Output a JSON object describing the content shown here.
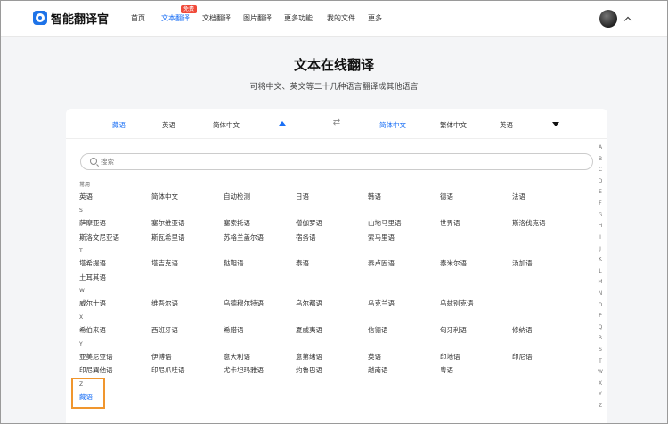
{
  "header": {
    "brand": "智能翻译官",
    "nav": [
      "首页",
      "文本翻译",
      "文档翻译",
      "图片翻译",
      "更多功能",
      "我的文件",
      "更多"
    ],
    "hot_badge": "免费"
  },
  "main": {
    "title": "文本在线翻译",
    "subtitle": "可将中文、英文等二十几种语言翻译成其他语言"
  },
  "lang_bar": {
    "source": [
      "藏语",
      "英语",
      "简体中文"
    ],
    "target": [
      "简体中文",
      "繁体中文",
      "英语"
    ]
  },
  "search": {
    "placeholder": "搜索"
  },
  "groups": {
    "common": {
      "label": "常用",
      "langs": [
        "英语",
        "简体中文",
        "自动检测",
        "日语",
        "韩语",
        "德语",
        "法语"
      ]
    },
    "s": {
      "label": "S",
      "row1": [
        "萨摩亚语",
        "塞尔维亚语",
        "塞索托语",
        "僧伽罗语",
        "山地马里语",
        "世界语",
        "斯洛伐克语"
      ],
      "row2": [
        "斯洛文尼亚语",
        "斯瓦希里语",
        "苏格兰盖尔语",
        "宿务语",
        "索马里语"
      ]
    },
    "t": {
      "label": "T",
      "row1": [
        "塔希提语",
        "塔吉克语",
        "鞑靼语",
        "泰语",
        "泰卢固语",
        "泰米尔语",
        "汤加语"
      ],
      "row2": [
        "土耳其语"
      ]
    },
    "w": {
      "label": "W",
      "row1": [
        "威尔士语",
        "维吾尔语",
        "乌德穆尔特语",
        "乌尔都语",
        "乌克兰语",
        "乌兹别克语"
      ]
    },
    "x": {
      "label": "X",
      "row1": [
        "希伯来语",
        "西班牙语",
        "希腊语",
        "夏威夷语",
        "信德语",
        "匈牙利语",
        "修纳语"
      ]
    },
    "y": {
      "label": "Y",
      "row1": [
        "亚美尼亚语",
        "伊博语",
        "意大利语",
        "意第绪语",
        "英语",
        "印地语",
        "印尼语"
      ],
      "row2": [
        "印尼巽他语",
        "印尼爪哇语",
        "尤卡坦玛雅语",
        "约鲁巴语",
        "越南语",
        "粤语"
      ]
    },
    "z": {
      "label": "Z",
      "langs": [
        "藏语"
      ]
    }
  },
  "alphabet": [
    "A",
    "B",
    "C",
    "D",
    "E",
    "F",
    "G",
    "H",
    "I",
    "J",
    "K",
    "L",
    "M",
    "N",
    "O",
    "P",
    "Q",
    "R",
    "S",
    "T",
    "W",
    "X",
    "Y",
    "Z"
  ],
  "colors": {
    "accent": "#1a6ff5",
    "highlight": "#f0962e",
    "badge": "#f04a3a"
  }
}
